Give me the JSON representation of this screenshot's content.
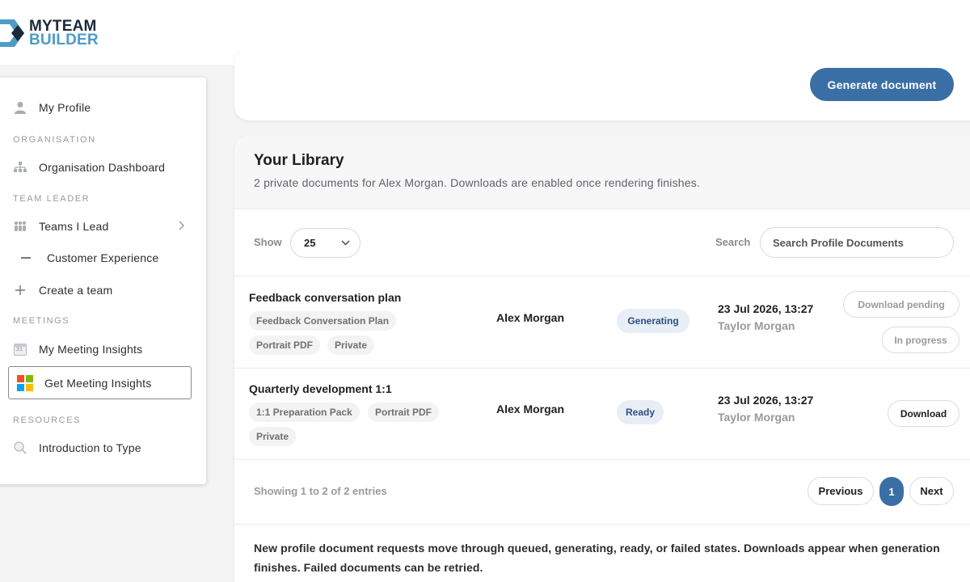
{
  "brand": {
    "line1": "MYTEAM",
    "line2": "BUILDER",
    "colors": {
      "dark": "#1b2a3a",
      "accent": "#4e9bc7"
    }
  },
  "sidebar": {
    "my_profile": "My Profile",
    "sections": {
      "organisation": "ORGANISATION",
      "team_leader": "TEAM LEADER",
      "meetings": "MEETINGS",
      "resources": "RESOURCES"
    },
    "org_dashboard": "Organisation Dashboard",
    "teams_i_lead": "Teams I Lead",
    "customer_experience": "Customer Experience",
    "create_team": "Create a team",
    "my_meeting_insights": "My Meeting Insights",
    "calendar_day": "31",
    "get_meeting_insights": "Get Meeting Insights",
    "intro_to_type": "Introduction to Type"
  },
  "header": {
    "generate_button": "Generate document",
    "accent_color": "#3a6fa6"
  },
  "library": {
    "title": "Your Library",
    "subtitle": "2 private documents for Alex Morgan. Downloads are enabled once rendering finishes.",
    "show_label": "Show",
    "show_value": "25",
    "search_label": "Search",
    "search_placeholder": "Search Profile Documents",
    "rows": [
      {
        "title": "Feedback conversation plan",
        "tags": [
          "Feedback Conversation Plan",
          "Portrait PDF",
          "Private"
        ],
        "owner": "Alex Morgan",
        "status": "Generating",
        "date": "23 Jul 2026, 13:27",
        "by": "Taylor Morgan",
        "actions": [
          "Download pending",
          "In progress"
        ]
      },
      {
        "title": "Quarterly development 1:1",
        "tags": [
          "1:1 Preparation Pack",
          "Portrait PDF",
          "Private"
        ],
        "owner": "Alex Morgan",
        "status": "Ready",
        "date": "23 Jul 2026, 13:27",
        "by": "Taylor Morgan",
        "actions": [
          "Download"
        ]
      }
    ],
    "showing": "Showing 1 to 2 of 2 entries",
    "pagination": {
      "previous": "Previous",
      "current": "1",
      "next": "Next"
    },
    "note": "New profile document requests move through queued, generating, ready, or failed states. Downloads appear when generation finishes. Failed documents can be retried."
  }
}
